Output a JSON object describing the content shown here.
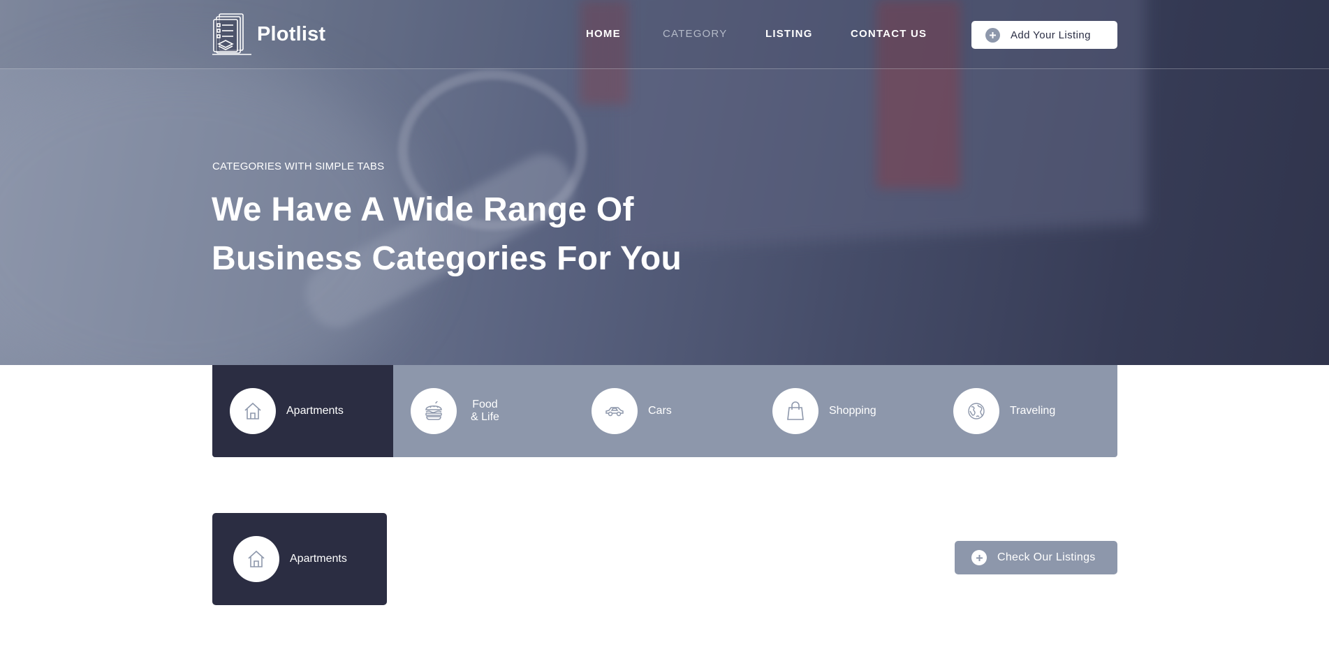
{
  "brand": {
    "name": "Plotlist",
    "logo_icon": "document-stack-icon"
  },
  "nav": {
    "items": [
      {
        "label": "HOME",
        "active": false
      },
      {
        "label": "CATEGORY",
        "active": true
      },
      {
        "label": "LISTING",
        "active": false
      },
      {
        "label": "CONTACT US",
        "active": false
      }
    ],
    "cta_label": "Add Your Listing",
    "cta_icon": "plus-circle-icon"
  },
  "hero": {
    "eyebrow": "CATEGORIES WITH SIMPLE TABS",
    "title_line1": "We Have A Wide Range Of",
    "title_line2": "Business Categories For You"
  },
  "tabs": [
    {
      "label": "Apartments",
      "icon": "house-icon",
      "active": true
    },
    {
      "label": "Food\n& Life",
      "icon": "burger-icon",
      "active": false
    },
    {
      "label": "Cars",
      "icon": "car-icon",
      "active": false
    },
    {
      "label": "Shopping",
      "icon": "shopping-bag-icon",
      "active": false
    },
    {
      "label": "Traveling",
      "icon": "globe-icon",
      "active": false
    }
  ],
  "content": {
    "card_label": "Apartments",
    "card_icon": "house-icon",
    "check_label": "Check Our Listings",
    "check_icon": "plus-circle-icon"
  },
  "colors": {
    "dark": "#2b2d42",
    "slate": "#8d97ab",
    "white": "#ffffff",
    "nav_active": "#b4bac8"
  }
}
